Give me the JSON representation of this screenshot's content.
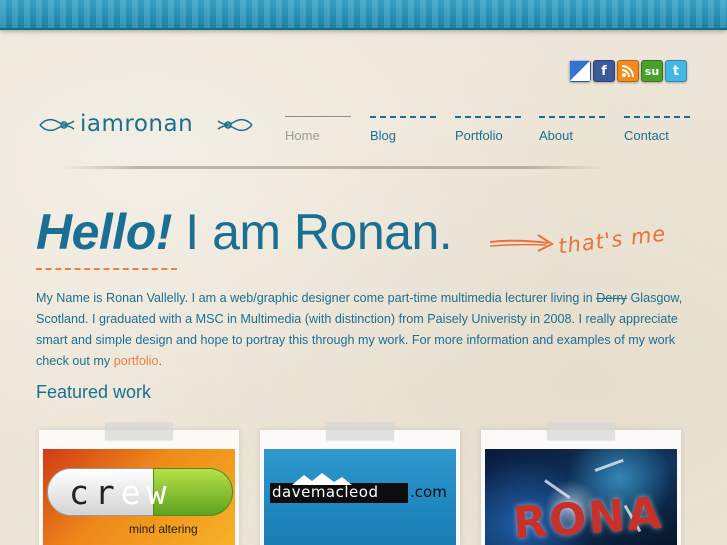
{
  "social": [
    {
      "name": "delicious",
      "glyph": "",
      "bg": "#3274d1"
    },
    {
      "name": "facebook",
      "glyph": "f",
      "bg": "#3b5998"
    },
    {
      "name": "rss",
      "glyph": ")",
      "bg": "#f28a1e"
    },
    {
      "name": "stumbleupon",
      "glyph": "su",
      "bg": "#4aa02c"
    },
    {
      "name": "twitter",
      "glyph": "t",
      "bg": "#41b7e3"
    }
  ],
  "logo": {
    "text": "iamronan"
  },
  "nav": [
    {
      "label": "Home",
      "active": true
    },
    {
      "label": "Blog",
      "active": false
    },
    {
      "label": "Portfolio",
      "active": false
    },
    {
      "label": "About",
      "active": false
    },
    {
      "label": "Contact",
      "active": false
    }
  ],
  "headline": {
    "bold": "Hello!",
    "rest": " I am Ronan.",
    "aside": "that's me"
  },
  "intro": {
    "part1": "My Name is Ronan Vallelly. I am a web/graphic designer come part-time multimedia lecturer living in ",
    "struck": "Derry",
    "part2": " Glasgow, Scotland. I graduated with a MSC in Multimedia (with distinction) from Paisely Univeristy in 2008. I really appreciate smart and simple design and hope to portray this through my work. For more information and examples of my work check out my ",
    "link": "portfolio",
    "part3": "."
  },
  "featured": {
    "heading": "Featured work",
    "items": [
      {
        "title_part1": "cr",
        "title_highlight": "ew",
        "subtitle": "mind altering"
      },
      {
        "title": "davemacleod",
        "suffix": ".com"
      },
      {
        "title": "RONA"
      }
    ]
  },
  "colors": {
    "brand_blue": "#1a6f93",
    "accent_orange": "#e8833f",
    "band_teal": "#2a97bd"
  }
}
